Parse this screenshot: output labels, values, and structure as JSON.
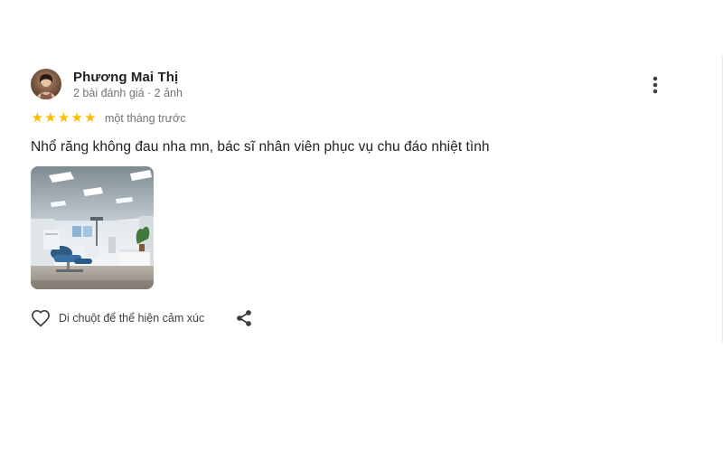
{
  "review": {
    "author_name": "Phương Mai Thị",
    "author_meta": "2 bài đánh giá · 2 ảnh",
    "avatar_icon": "user-avatar",
    "rating": 5,
    "rating_max": 5,
    "star_glyph": "★",
    "date": "một tháng trước",
    "text": "Nhổ răng không đau nha mn, bác sĩ nhân viên phục vụ chu đáo nhiệt tình",
    "photo_icon": "dental-clinic-photo",
    "more_icon": "more-vert-icon"
  },
  "actions": {
    "react_label": "Di chuột để thể hiện cảm xúc",
    "react_icon": "heart-outline-icon",
    "share_icon": "share-icon"
  },
  "colors": {
    "star": "#fbbc04",
    "meta_text": "#70757a",
    "primary_text": "#202124",
    "icon": "#3c4043"
  }
}
